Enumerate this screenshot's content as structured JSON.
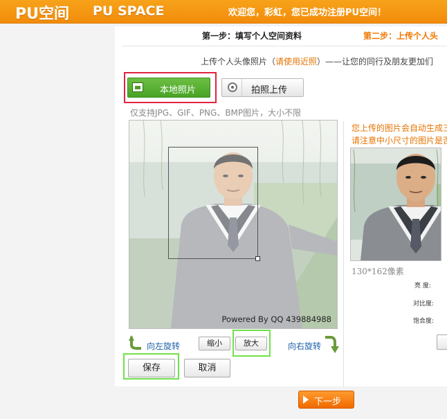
{
  "header": {
    "logo_cn": "PU空间",
    "logo_en": "PU SPACE",
    "welcome": "欢迎您，彩虹，您已成功注册PU空间！"
  },
  "steps": {
    "step1": "第一步：填写个人空间资料",
    "step2": "第二步：上传个人头"
  },
  "instruction": {
    "prefix": "上传个人头像照片（",
    "highlight": "请使用近照",
    "suffix": "）——让您的同行及朋友更加们"
  },
  "upload": {
    "local_label": "本地照片",
    "local_icon": "image-upload-icon",
    "camera_label": "拍照上传",
    "camera_icon": "webcam-icon",
    "format_hint": "仅支持JPG、GIF、PNG、BMP图片，大小不限"
  },
  "photo": {
    "watermark": "Powered By QQ 439884988"
  },
  "controls": {
    "rotate_left": "向左旋转",
    "rotate_right": "向右旋转",
    "shrink": "缩小",
    "enlarge": "放大",
    "save": "保存",
    "cancel": "取消"
  },
  "preview": {
    "note1": "您上传的图片会自动生成三",
    "note2": "请注意中小尺寸的图片是否",
    "size": "130*162像素",
    "brightness": "亮   度:",
    "contrast": "对比度:",
    "saturation": "饱合度:"
  },
  "next_label": "下一步",
  "colors": {
    "brand_orange": "#f28c0a",
    "accent_orange": "#e67300",
    "link_blue": "#1a5fa8",
    "green_button": "#48a326",
    "highlight_red": "#e0233f",
    "highlight_green": "#6ee24a"
  }
}
